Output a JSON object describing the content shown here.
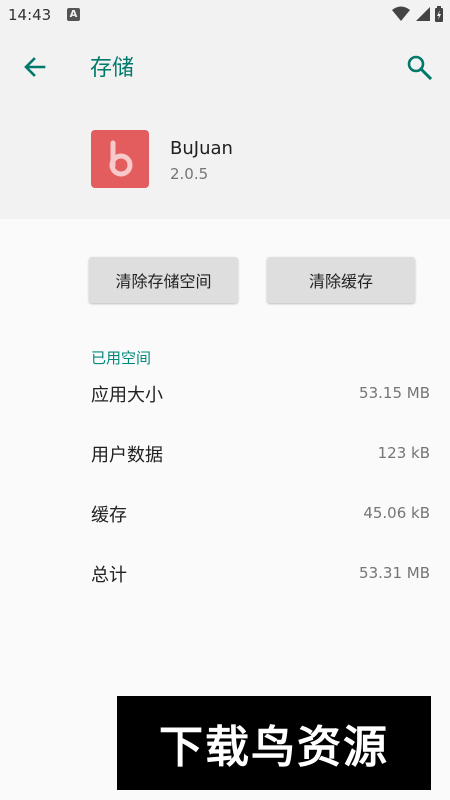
{
  "status_bar": {
    "time": "14:43",
    "notification_letter": "A"
  },
  "header": {
    "title": "存储",
    "back_icon": "arrow-left-icon",
    "search_icon": "search-icon"
  },
  "app": {
    "name": "BuJuan",
    "version": "2.0.5",
    "icon_letter": "b",
    "icon_color": "#e35d5f"
  },
  "buttons": {
    "clear_storage": "清除存储空间",
    "clear_cache": "清除缓存"
  },
  "section": {
    "title": "已用空间"
  },
  "storage_rows": [
    {
      "label": "应用大小",
      "value": "53.15 MB"
    },
    {
      "label": "用户数据",
      "value": "123 kB"
    },
    {
      "label": "缓存",
      "value": "45.06 kB"
    },
    {
      "label": "总计",
      "value": "53.31 MB"
    }
  ],
  "watermark": {
    "text": "下载鸟资源"
  },
  "colors": {
    "accent": "#00796b",
    "section_accent": "#00897b",
    "header_bg": "#f2f2f2"
  }
}
